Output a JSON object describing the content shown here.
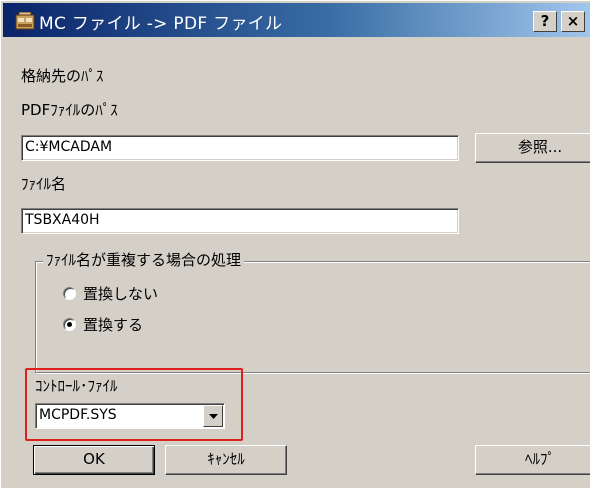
{
  "window": {
    "title": "MC ファイル -> PDF ファイル",
    "help_button": "?",
    "close_button": "×"
  },
  "form": {
    "destination_label": "格納先のﾊﾟｽ",
    "pdf_path_label": "PDFﾌｧｲﾙのﾊﾟｽ",
    "pdf_path_value": "C:¥MCADAM",
    "browse_button": "参照...",
    "filename_label": "ﾌｧｲﾙ名",
    "filename_value": "TSBXA40H",
    "duplicate_group": {
      "legend": "ﾌｧｲﾙ名が重複する場合の処理",
      "options": [
        {
          "label": "置換しない",
          "selected": false
        },
        {
          "label": "置換する",
          "selected": true
        }
      ]
    },
    "control_file_label": "ｺﾝﾄﾛｰﾙ･ﾌｧｲﾙ",
    "control_file_value": "MCPDF.SYS"
  },
  "buttons": {
    "ok": "OK",
    "cancel": "ｷｬﾝｾﾙ",
    "help": "ﾍﾙﾌﾟ"
  },
  "colors": {
    "dialog_face": "#d4d0c8",
    "titlebar_start": "#0a246a",
    "titlebar_end": "#a6caf0",
    "highlight_border": "#e0201c"
  },
  "icons": {
    "app": "app-window-icon",
    "combo_arrow": "chevron-down-icon"
  }
}
